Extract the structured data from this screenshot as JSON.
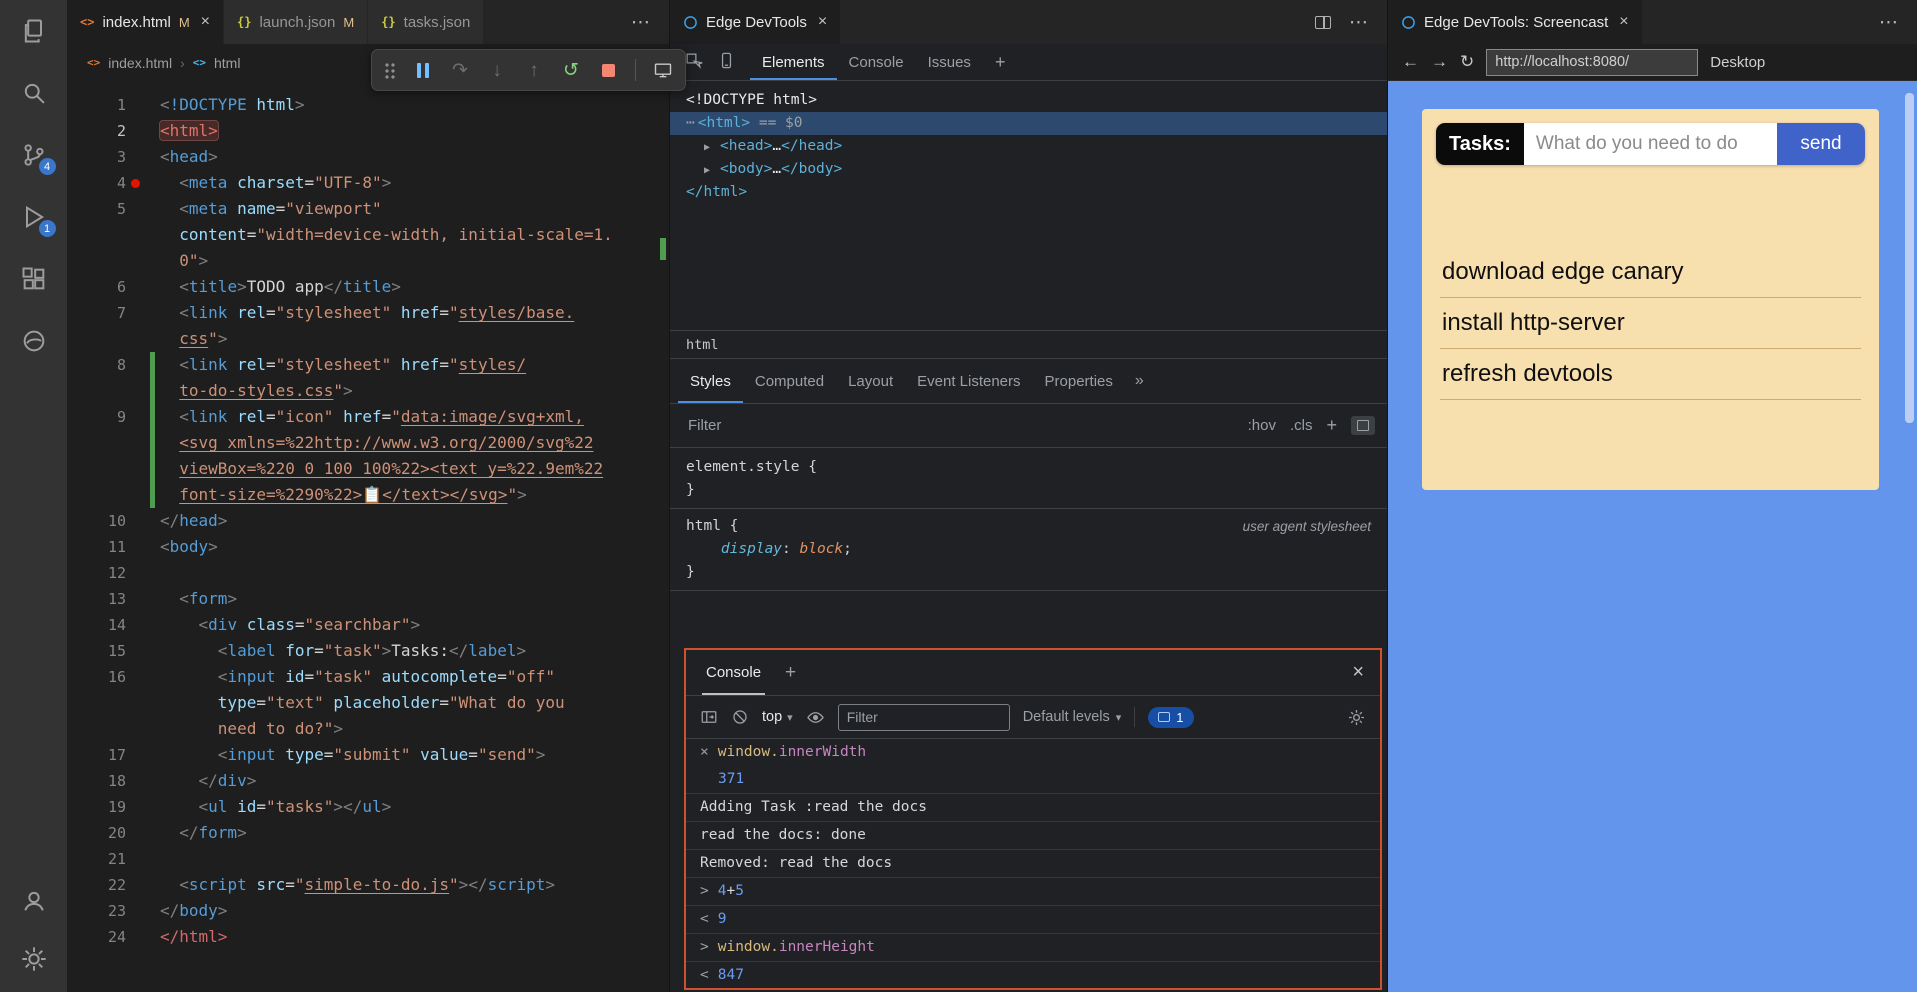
{
  "glyphs": {
    "close": "×",
    "more": "⋯",
    "plus": "+",
    "caret": "▾",
    "crumb_sep": "›",
    "more_tabs": "»",
    "back": "←",
    "forward": "→",
    "reload": "↻",
    "restart": "↺",
    "step_over": "↷",
    "step_into": "↓",
    "step_out": "↑",
    "html_icon": "<>",
    "json_icon": "{}"
  },
  "activity_bar": {
    "items": [
      "explorer",
      "search",
      "source-control",
      "run-and-debug",
      "extensions",
      "edge-devtools",
      "accounts",
      "settings"
    ],
    "scm_badge": "4",
    "debug_badge": "1"
  },
  "tabs_group1": [
    {
      "icon": "html",
      "label": "index.html",
      "modified": "M",
      "active": true,
      "close": "×"
    },
    {
      "icon": "json",
      "label": "launch.json",
      "modified": "M",
      "active": false
    },
    {
      "icon": "json",
      "label": "tasks.json",
      "active": false
    }
  ],
  "breadcrumb": {
    "file": "index.html",
    "symbol": "html"
  },
  "code": {
    "rows": [
      {
        "n": "1",
        "s": [
          [
            "p",
            "<"
          ],
          [
            "t",
            "!DOCTYPE"
          ],
          [
            "x",
            " "
          ],
          [
            "a",
            "html"
          ],
          [
            "p",
            ">"
          ]
        ]
      },
      {
        "n": "2",
        "active": true,
        "s": [
          [
            "rb",
            "<html>"
          ]
        ]
      },
      {
        "n": "3",
        "s": [
          [
            "p",
            "<"
          ],
          [
            "t",
            "head"
          ],
          [
            "p",
            ">"
          ]
        ]
      },
      {
        "n": "4",
        "bp": true,
        "s": [
          [
            "x",
            "  "
          ],
          [
            "p",
            "<"
          ],
          [
            "t",
            "meta"
          ],
          [
            "x",
            " "
          ],
          [
            "a",
            "charset"
          ],
          [
            "x",
            "="
          ],
          [
            "s",
            "\"UTF-8\""
          ],
          [
            "p",
            ">"
          ]
        ]
      },
      {
        "n": "5",
        "s": [
          [
            "x",
            "  "
          ],
          [
            "p",
            "<"
          ],
          [
            "t",
            "meta"
          ],
          [
            "x",
            " "
          ],
          [
            "a",
            "name"
          ],
          [
            "x",
            "="
          ],
          [
            "s",
            "\"viewport\""
          ]
        ]
      },
      {
        "n": "",
        "s": [
          [
            "x",
            "  "
          ],
          [
            "a",
            "content"
          ],
          [
            "x",
            "="
          ],
          [
            "s",
            "\"width=device-width, initial-scale=1."
          ]
        ]
      },
      {
        "n": "",
        "s": [
          [
            "x",
            "  "
          ],
          [
            "s",
            "0\""
          ],
          [
            "p",
            ">"
          ]
        ]
      },
      {
        "n": "6",
        "s": [
          [
            "x",
            "  "
          ],
          [
            "p",
            "<"
          ],
          [
            "t",
            "title"
          ],
          [
            "p",
            ">"
          ],
          [
            "x",
            "TODO app"
          ],
          [
            "p",
            "</"
          ],
          [
            "t",
            "title"
          ],
          [
            "p",
            ">"
          ]
        ]
      },
      {
        "n": "7",
        "s": [
          [
            "x",
            "  "
          ],
          [
            "p",
            "<"
          ],
          [
            "t",
            "link"
          ],
          [
            "x",
            " "
          ],
          [
            "a",
            "rel"
          ],
          [
            "x",
            "="
          ],
          [
            "s",
            "\"stylesheet\""
          ],
          [
            "x",
            " "
          ],
          [
            "a",
            "href"
          ],
          [
            "x",
            "="
          ],
          [
            "s",
            "\""
          ],
          [
            "l",
            "styles/base."
          ]
        ]
      },
      {
        "n": "",
        "s": [
          [
            "x",
            "  "
          ],
          [
            "l",
            "css"
          ],
          [
            "s",
            "\""
          ],
          [
            "p",
            ">"
          ]
        ]
      },
      {
        "n": "8",
        "git": true,
        "s": [
          [
            "x",
            "  "
          ],
          [
            "p",
            "<"
          ],
          [
            "t",
            "link"
          ],
          [
            "x",
            " "
          ],
          [
            "a",
            "rel"
          ],
          [
            "x",
            "="
          ],
          [
            "s",
            "\"stylesheet\""
          ],
          [
            "x",
            " "
          ],
          [
            "a",
            "href"
          ],
          [
            "x",
            "="
          ],
          [
            "s",
            "\""
          ],
          [
            "l",
            "styles/"
          ]
        ]
      },
      {
        "n": "",
        "git": true,
        "s": [
          [
            "x",
            "  "
          ],
          [
            "l",
            "to-do-styles.css"
          ],
          [
            "s",
            "\""
          ],
          [
            "p",
            ">"
          ]
        ]
      },
      {
        "n": "9",
        "git": true,
        "s": [
          [
            "x",
            "  "
          ],
          [
            "p",
            "<"
          ],
          [
            "t",
            "link"
          ],
          [
            "x",
            " "
          ],
          [
            "a",
            "rel"
          ],
          [
            "x",
            "="
          ],
          [
            "s",
            "\"icon\""
          ],
          [
            "x",
            " "
          ],
          [
            "a",
            "href"
          ],
          [
            "x",
            "="
          ],
          [
            "s",
            "\""
          ],
          [
            "l",
            "data:image/svg+xml,"
          ]
        ]
      },
      {
        "n": "",
        "git": true,
        "s": [
          [
            "x",
            "  "
          ],
          [
            "l",
            "<svg xmlns=%22http://www.w3.org/2000/svg%22"
          ]
        ]
      },
      {
        "n": "",
        "git": true,
        "s": [
          [
            "x",
            "  "
          ],
          [
            "l",
            "viewBox=%220 0 100 100%22><text y=%22.9em%22"
          ]
        ]
      },
      {
        "n": "",
        "git": true,
        "s": [
          [
            "x",
            "  "
          ],
          [
            "l",
            "font-size=%2290%22>📋</text></svg>"
          ],
          [
            "s",
            "\""
          ],
          [
            "p",
            ">"
          ]
        ]
      },
      {
        "n": "10",
        "s": [
          [
            "p",
            "</"
          ],
          [
            "t",
            "head"
          ],
          [
            "p",
            ">"
          ]
        ]
      },
      {
        "n": "11",
        "s": [
          [
            "p",
            "<"
          ],
          [
            "t",
            "body"
          ],
          [
            "p",
            ">"
          ]
        ]
      },
      {
        "n": "12",
        "s": []
      },
      {
        "n": "13",
        "s": [
          [
            "x",
            "  "
          ],
          [
            "p",
            "<"
          ],
          [
            "t",
            "form"
          ],
          [
            "p",
            ">"
          ]
        ]
      },
      {
        "n": "14",
        "s": [
          [
            "x",
            "    "
          ],
          [
            "p",
            "<"
          ],
          [
            "t",
            "div"
          ],
          [
            "x",
            " "
          ],
          [
            "a",
            "class"
          ],
          [
            "x",
            "="
          ],
          [
            "s",
            "\"searchbar\""
          ],
          [
            "p",
            ">"
          ]
        ]
      },
      {
        "n": "15",
        "s": [
          [
            "x",
            "      "
          ],
          [
            "p",
            "<"
          ],
          [
            "t",
            "label"
          ],
          [
            "x",
            " "
          ],
          [
            "a",
            "for"
          ],
          [
            "x",
            "="
          ],
          [
            "s",
            "\"task\""
          ],
          [
            "p",
            ">"
          ],
          [
            "x",
            "Tasks:"
          ],
          [
            "p",
            "</"
          ],
          [
            "t",
            "label"
          ],
          [
            "p",
            ">"
          ]
        ]
      },
      {
        "n": "16",
        "s": [
          [
            "x",
            "      "
          ],
          [
            "p",
            "<"
          ],
          [
            "t",
            "input"
          ],
          [
            "x",
            " "
          ],
          [
            "a",
            "id"
          ],
          [
            "x",
            "="
          ],
          [
            "s",
            "\"task\""
          ],
          [
            "x",
            " "
          ],
          [
            "a",
            "autocomplete"
          ],
          [
            "x",
            "="
          ],
          [
            "s",
            "\"off\""
          ]
        ]
      },
      {
        "n": "",
        "s": [
          [
            "x",
            "      "
          ],
          [
            "a",
            "type"
          ],
          [
            "x",
            "="
          ],
          [
            "s",
            "\"text\""
          ],
          [
            "x",
            " "
          ],
          [
            "a",
            "placeholder"
          ],
          [
            "x",
            "="
          ],
          [
            "s",
            "\"What do you"
          ]
        ]
      },
      {
        "n": "",
        "s": [
          [
            "x",
            "      "
          ],
          [
            "s",
            "need to do?\""
          ],
          [
            "p",
            ">"
          ]
        ]
      },
      {
        "n": "17",
        "s": [
          [
            "x",
            "      "
          ],
          [
            "p",
            "<"
          ],
          [
            "t",
            "input"
          ],
          [
            "x",
            " "
          ],
          [
            "a",
            "type"
          ],
          [
            "x",
            "="
          ],
          [
            "s",
            "\"submit\""
          ],
          [
            "x",
            " "
          ],
          [
            "a",
            "value"
          ],
          [
            "x",
            "="
          ],
          [
            "s",
            "\"send\""
          ],
          [
            "p",
            ">"
          ]
        ]
      },
      {
        "n": "18",
        "s": [
          [
            "x",
            "    "
          ],
          [
            "p",
            "</"
          ],
          [
            "t",
            "div"
          ],
          [
            "p",
            ">"
          ]
        ]
      },
      {
        "n": "19",
        "s": [
          [
            "x",
            "    "
          ],
          [
            "p",
            "<"
          ],
          [
            "t",
            "ul"
          ],
          [
            "x",
            " "
          ],
          [
            "a",
            "id"
          ],
          [
            "x",
            "="
          ],
          [
            "s",
            "\"tasks\""
          ],
          [
            "p",
            ">"
          ],
          [
            "p",
            "</"
          ],
          [
            "t",
            "ul"
          ],
          [
            "p",
            ">"
          ]
        ]
      },
      {
        "n": "20",
        "s": [
          [
            "x",
            "  "
          ],
          [
            "p",
            "</"
          ],
          [
            "t",
            "form"
          ],
          [
            "p",
            ">"
          ]
        ]
      },
      {
        "n": "21",
        "s": []
      },
      {
        "n": "22",
        "s": [
          [
            "x",
            "  "
          ],
          [
            "p",
            "<"
          ],
          [
            "t",
            "script"
          ],
          [
            "x",
            " "
          ],
          [
            "a",
            "src"
          ],
          [
            "x",
            "="
          ],
          [
            "s",
            "\""
          ],
          [
            "l",
            "simple-to-do.js"
          ],
          [
            "s",
            "\""
          ],
          [
            "p",
            ">"
          ],
          [
            "p",
            "</"
          ],
          [
            "t",
            "script"
          ],
          [
            "p",
            ">"
          ]
        ]
      },
      {
        "n": "23",
        "s": [
          [
            "p",
            "</"
          ],
          [
            "t",
            "body"
          ],
          [
            "p",
            ">"
          ]
        ]
      },
      {
        "n": "24",
        "s": [
          [
            "r",
            "</html>"
          ]
        ]
      }
    ]
  },
  "devtools": {
    "tab_label": "Edge DevTools",
    "tool_tabs": [
      "Elements",
      "Console",
      "Issues"
    ],
    "tree": [
      {
        "indent": 0,
        "segs": [
          [
            "w",
            "<!DOCTYPE html>"
          ]
        ]
      },
      {
        "indent": 0,
        "selected": true,
        "menu": true,
        "segs": [
          [
            "t",
            "<html>"
          ],
          [
            "eq",
            " == $0"
          ]
        ]
      },
      {
        "indent": 1,
        "arrow": true,
        "segs": [
          [
            "t",
            "<head>"
          ],
          [
            "w",
            "…"
          ],
          [
            "t",
            "</head>"
          ]
        ]
      },
      {
        "indent": 1,
        "arrow": true,
        "segs": [
          [
            "t",
            "<body>"
          ],
          [
            "w",
            "…"
          ],
          [
            "t",
            "</body>"
          ]
        ]
      },
      {
        "indent": 0,
        "segs": [
          [
            "t",
            "</html>"
          ]
        ]
      }
    ],
    "dom_breadcrumb": "html",
    "styles": {
      "tabs": [
        "Styles",
        "Computed",
        "Layout",
        "Event Listeners",
        "Properties"
      ],
      "filter_placeholder": "Filter",
      "hov": ":hov",
      "cls": ".cls",
      "rule1_selector": "element.style",
      "brace_open": "{",
      "brace_close": "}",
      "rule2_selector": "html",
      "prop_name": "display",
      "prop_value": "block",
      "ua_label": "user agent stylesheet"
    }
  },
  "console": {
    "title": "Console",
    "context": "top",
    "filter_placeholder": "Filter",
    "levels_label": "Default levels",
    "issue_count": "1",
    "rows": [
      {
        "kind": "live",
        "segs": [
          [
            "obj",
            "window."
          ],
          [
            "prop",
            "innerWidth"
          ]
        ]
      },
      {
        "kind": "val",
        "text": "371"
      },
      {
        "kind": "log",
        "text": "Adding Task :read the docs"
      },
      {
        "kind": "log",
        "text": "read the docs: done"
      },
      {
        "kind": "log",
        "text": "Removed: read the docs"
      },
      {
        "kind": "in",
        "segs": [
          [
            "num",
            "4"
          ],
          [
            "w",
            "+"
          ],
          [
            "num",
            "5"
          ]
        ]
      },
      {
        "kind": "out",
        "text": "9"
      },
      {
        "kind": "in",
        "segs": [
          [
            "obj",
            "window."
          ],
          [
            "prop",
            "innerHeight"
          ]
        ]
      },
      {
        "kind": "out",
        "text": "847"
      }
    ]
  },
  "screencast": {
    "tab_label": "Edge DevTools: Screencast",
    "url": "http://localhost:8080/",
    "device_label": "Desktop",
    "app": {
      "task_label": "Tasks:",
      "input_placeholder": "What do you need to do",
      "send_label": "send",
      "tasks": [
        "download edge canary",
        "install http-server",
        "refresh devtools"
      ]
    }
  }
}
